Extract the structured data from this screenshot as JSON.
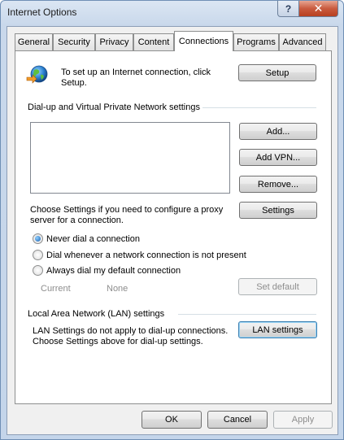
{
  "window": {
    "title": "Internet Options",
    "help_glyph": "?",
    "close_glyph": "✕"
  },
  "tabs": [
    {
      "label": "General"
    },
    {
      "label": "Security"
    },
    {
      "label": "Privacy"
    },
    {
      "label": "Content"
    },
    {
      "label": "Connections",
      "active": true
    },
    {
      "label": "Programs"
    },
    {
      "label": "Advanced"
    }
  ],
  "setup": {
    "icon": "globe-network-icon",
    "text_line1": "To set up an Internet connection, click",
    "text_line2": "Setup.",
    "button": "Setup"
  },
  "dialup": {
    "group_label": "Dial-up and Virtual Private Network settings",
    "add_button": "Add...",
    "add_vpn_button": "Add VPN...",
    "remove_button": "Remove...",
    "settings_text_line1": "Choose Settings if you need to configure a proxy",
    "settings_text_line2": "server for a connection.",
    "settings_button": "Settings",
    "options": [
      {
        "label": "Never dial a connection",
        "checked": true
      },
      {
        "label": "Dial whenever a network connection is not present",
        "checked": false
      },
      {
        "label": "Always dial my default connection",
        "checked": false
      }
    ],
    "current_label": "Current",
    "current_value": "None",
    "set_default_button": "Set default"
  },
  "lan": {
    "group_label": "Local Area Network (LAN) settings",
    "text_line1": "LAN Settings do not apply to dial-up connections.",
    "text_line2": "Choose Settings above for dial-up settings.",
    "button": "LAN settings"
  },
  "footer": {
    "ok": "OK",
    "cancel": "Cancel",
    "apply": "Apply"
  },
  "colors": {
    "accent": "#3c7fb1",
    "title_bar": "#c4d5ea",
    "close": "#c95b3f"
  }
}
